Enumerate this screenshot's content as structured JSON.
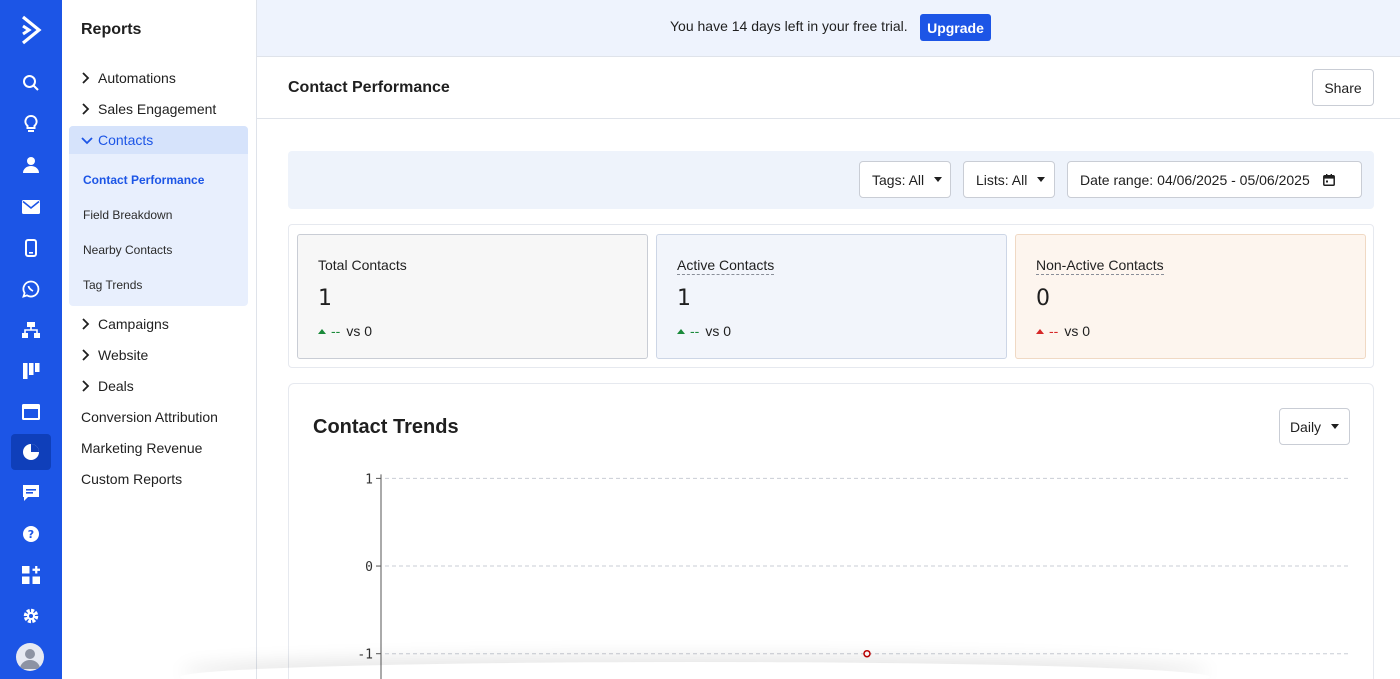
{
  "sidebar": {
    "title": "Reports",
    "items_top": [
      {
        "label": "Automations",
        "expandable": true
      },
      {
        "label": "Sales Engagement",
        "expandable": true
      }
    ],
    "contacts_group": {
      "label": "Contacts",
      "subitems": [
        "Contact Performance",
        "Field Breakdown",
        "Nearby Contacts",
        "Tag Trends"
      ],
      "active_subitem": "Contact Performance"
    },
    "items_bottom": [
      {
        "label": "Campaigns",
        "expandable": true
      },
      {
        "label": "Website",
        "expandable": true
      },
      {
        "label": "Deals",
        "expandable": true
      },
      {
        "label": "Conversion Attribution",
        "expandable": false
      },
      {
        "label": "Marketing Revenue",
        "expandable": false
      },
      {
        "label": "Custom Reports",
        "expandable": false
      }
    ]
  },
  "rail_icons": [
    "logo-icon",
    "search-icon",
    "lightbulb-icon",
    "contacts-icon",
    "email-icon",
    "mobile-icon",
    "whatsapp-icon",
    "sitemap-icon",
    "pipeline-icon",
    "website-icon",
    "reports-icon",
    "conversations-icon",
    "help-icon",
    "apps-icon",
    "settings-icon",
    "avatar"
  ],
  "banner": {
    "text": "You have 14 days left in your free trial.",
    "upgrade_label": "Upgrade"
  },
  "page": {
    "title": "Contact Performance",
    "share_label": "Share"
  },
  "filters": {
    "tags": "Tags: All",
    "lists": "Lists: All",
    "date_label": "Date range:",
    "date_value": "04/06/2025 - 05/06/2025"
  },
  "stats": [
    {
      "label": "Total Contacts",
      "value": "1",
      "dashes": "--",
      "vs": "vs 0",
      "bg": "#f7f7f7",
      "arrow_color": "#1a8a3a",
      "underline": false
    },
    {
      "label": "Active Contacts",
      "value": "1",
      "dashes": "--",
      "vs": "vs 0",
      "bg": "#f2f5fb",
      "arrow_color": "#1a8a3a",
      "underline": true
    },
    {
      "label": "Non-Active Contacts",
      "value": "0",
      "dashes": "--",
      "vs": "vs 0",
      "bg": "#fdf5ee",
      "arrow_color": "#d62828",
      "underline": true
    }
  ],
  "trends": {
    "title": "Contact Trends",
    "interval": "Daily"
  },
  "chart_data": {
    "type": "scatter",
    "title": "Contact Trends",
    "ylim": [
      -1.3,
      1.05
    ],
    "yticks": [
      "1",
      "0",
      "-1"
    ],
    "grid": true,
    "points": [
      {
        "x": 0.5,
        "y": -1
      }
    ],
    "point_color": "#c00000"
  },
  "colors": {
    "brand": "#1c55e6",
    "positive": "#1a8a3a",
    "negative": "#d62828"
  }
}
